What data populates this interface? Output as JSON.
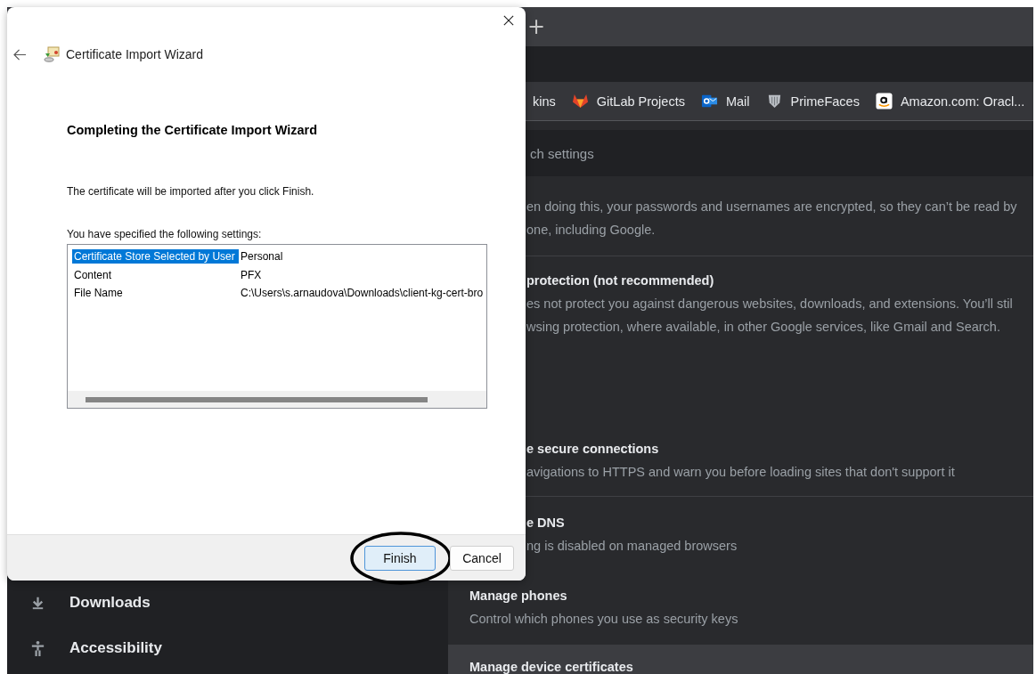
{
  "browser": {
    "new_tab": "+",
    "bookmarks": [
      {
        "label": "kins",
        "kind": "plain"
      },
      {
        "label": "GitLab Projects",
        "kind": "fox"
      },
      {
        "label": "Mail",
        "kind": "mail"
      },
      {
        "label": "PrimeFaces",
        "kind": "shield"
      },
      {
        "label": "Amazon.com: Oracl...",
        "kind": "amazon"
      }
    ],
    "search": {
      "placeholder": "ch settings"
    },
    "sidebar": [
      {
        "label": "Downloads",
        "kind": "download"
      },
      {
        "label": "Accessibility",
        "kind": "accessibility"
      }
    ],
    "partly_hidden_sections": [
      {
        "lines": [
          "en doing this, your passwords and usernames are encrypted, so they can’t be read by",
          "one, including Google."
        ]
      },
      {
        "title": "protection (not recommended)",
        "lines": [
          "es not protect you against dangerous websites, downloads, and extensions. You’ll stil",
          "wsing protection, where available, in other Google services, like Gmail and Search."
        ]
      },
      {
        "title": "e secure connections",
        "lines": [
          "avigations to HTTPS and warn you before loading sites that don't support it"
        ]
      },
      {
        "title": "e DNS",
        "lines": [
          "ng is disabled on managed browsers"
        ]
      }
    ],
    "sections": [
      {
        "title": "Manage phones",
        "lines": [
          "Control which phones you use as security keys"
        ],
        "highlighted": false
      },
      {
        "title": "Manage device certificates",
        "highlighted": true
      }
    ]
  },
  "dialog": {
    "title": "Certificate Import Wizard",
    "heading": "Completing the Certificate Import Wizard",
    "message": "The certificate will be imported after you click Finish.",
    "settings_label": "You have specified the following settings:",
    "settings": [
      {
        "name": "Certificate Store Selected by User",
        "value": "Personal",
        "selected": true
      },
      {
        "name": "Content",
        "value": "PFX",
        "selected": false
      },
      {
        "name": "File Name",
        "value": "C:\\Users\\s.arnaudova\\Downloads\\client-kg-cert-bro",
        "selected": false
      }
    ],
    "buttons": [
      {
        "label": "Finish",
        "kind": "default",
        "circled": true
      },
      {
        "label": "Cancel",
        "kind": "normal",
        "circled": false
      }
    ]
  }
}
